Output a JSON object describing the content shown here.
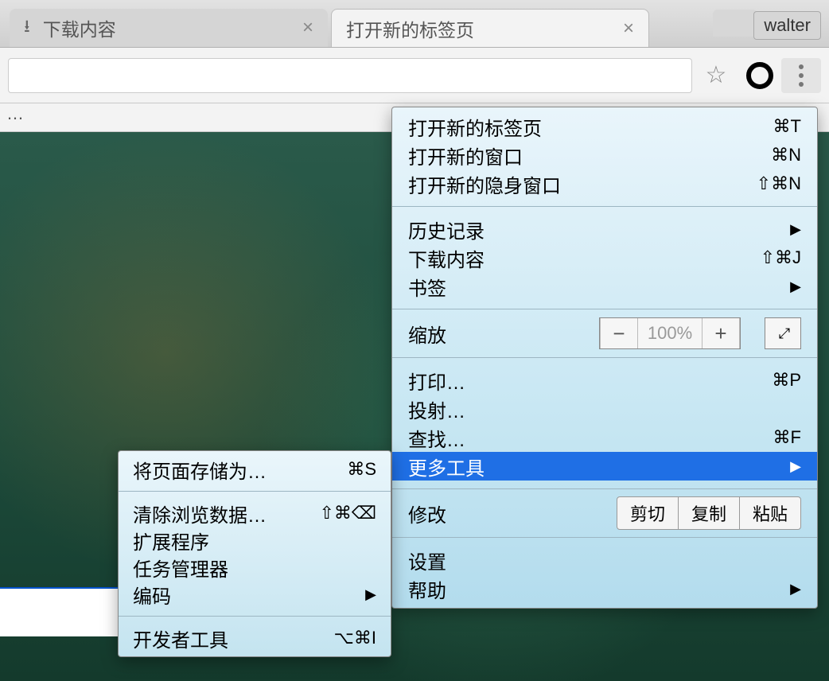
{
  "tabs": {
    "inactive": {
      "title": "下载内容"
    },
    "active": {
      "title": "打开新的标签页"
    }
  },
  "user_badge": "walter",
  "subbar_text": "…",
  "main_menu": {
    "new_tab": {
      "label": "打开新的标签页",
      "shortcut": "⌘T"
    },
    "new_window": {
      "label": "打开新的窗口",
      "shortcut": "⌘N"
    },
    "new_incognito": {
      "label": "打开新的隐身窗口",
      "shortcut": "⇧⌘N"
    },
    "history": {
      "label": "历史记录"
    },
    "downloads": {
      "label": "下载内容",
      "shortcut": "⇧⌘J"
    },
    "bookmarks": {
      "label": "书签"
    },
    "zoom": {
      "label": "缩放",
      "percent": "100%"
    },
    "print": {
      "label": "打印…",
      "shortcut": "⌘P"
    },
    "cast": {
      "label": "投射…"
    },
    "find": {
      "label": "查找…",
      "shortcut": "⌘F"
    },
    "more_tools": {
      "label": "更多工具"
    },
    "edit": {
      "label": "修改",
      "cut": "剪切",
      "copy": "复制",
      "paste": "粘贴"
    },
    "settings": {
      "label": "设置"
    },
    "help": {
      "label": "帮助"
    }
  },
  "submenu": {
    "save_as": {
      "label": "将页面存储为…",
      "shortcut": "⌘S"
    },
    "clear_data": {
      "label": "清除浏览数据…",
      "shortcut": "⇧⌘⌫"
    },
    "extensions": {
      "label": "扩展程序"
    },
    "task_manager": {
      "label": "任务管理器"
    },
    "encoding": {
      "label": "编码"
    },
    "devtools": {
      "label": "开发者工具",
      "shortcut": "⌥⌘I"
    }
  }
}
